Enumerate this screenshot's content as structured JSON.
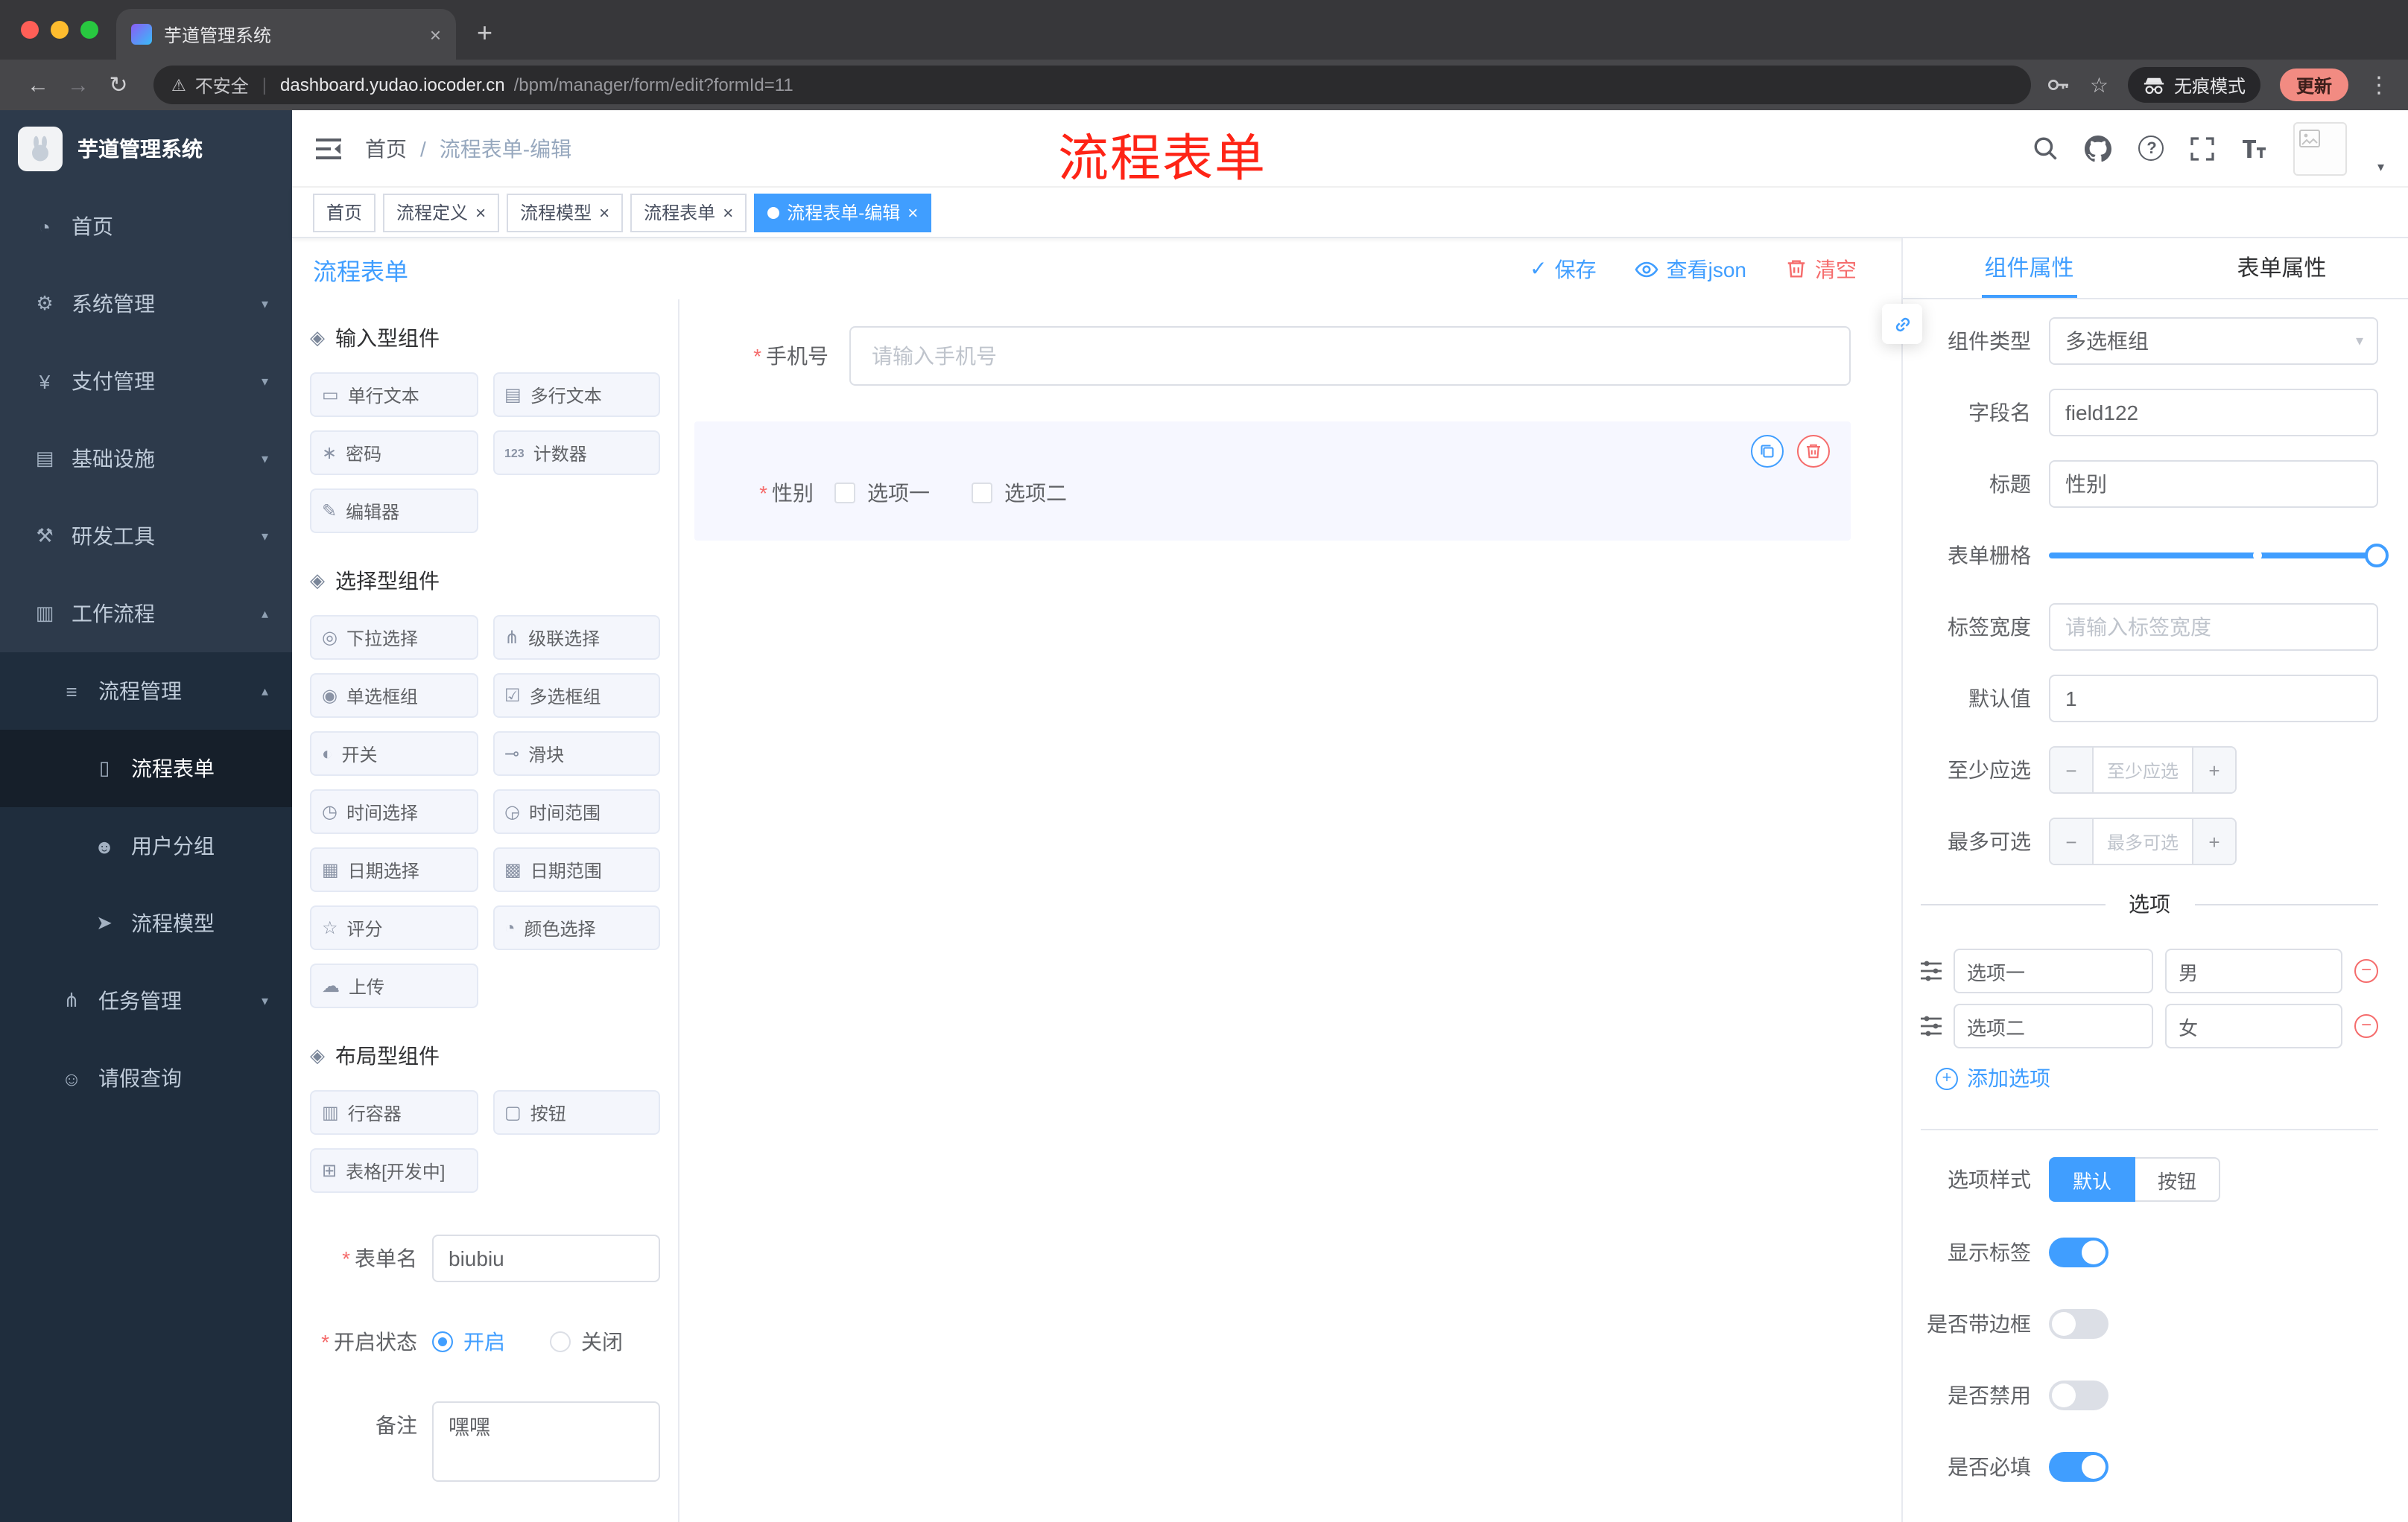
{
  "glyphs": {
    "close": "×",
    "new_tab": "+",
    "back": "←",
    "forward": "→",
    "reload": "↻",
    "warning": "⚠",
    "url_divider": "|",
    "star": "☆",
    "menu_dots": "⋮",
    "required": "*",
    "check": "✓",
    "caret_down": "▾",
    "caret_up": "▴",
    "question": "?",
    "plus": "+",
    "minus": "−",
    "avatar_caret": "▾"
  },
  "browser": {
    "tab_title": "芋道管理系统",
    "secure_label": "不安全",
    "url_domain": "dashboard.yudao.iocoder.cn",
    "url_path": "/bpm/manager/form/edit?formId=11",
    "incognito_label": "无痕模式",
    "update_label": "更新"
  },
  "sidebar": {
    "app_title": "芋道管理系统",
    "items": [
      {
        "label": "首页",
        "glyph": "◔",
        "active": false
      },
      {
        "label": "系统管理",
        "glyph": "⚙",
        "active": false
      },
      {
        "label": "支付管理",
        "glyph": "¥",
        "active": false
      },
      {
        "label": "基础设施",
        "glyph": "▤",
        "active": false
      },
      {
        "label": "研发工具",
        "glyph": "⚒",
        "active": false
      },
      {
        "label": "工作流程",
        "glyph": "▥",
        "active": false
      },
      {
        "label": "流程管理",
        "glyph": "≡",
        "active": false
      },
      {
        "label": "流程表单",
        "glyph": "▯",
        "active": true
      },
      {
        "label": "用户分组",
        "glyph": "☻",
        "active": false
      },
      {
        "label": "流程模型",
        "glyph": "➤",
        "active": false
      },
      {
        "label": "任务管理",
        "glyph": "⋔",
        "active": false
      },
      {
        "label": "请假查询",
        "glyph": "☺",
        "active": false
      }
    ]
  },
  "header": {
    "breadcrumb_home": "首页",
    "breadcrumb_sep": "/",
    "breadcrumb_current": "流程表单-编辑",
    "annotation": "流程表单"
  },
  "tags": {
    "items": [
      {
        "label": "首页",
        "active": false
      },
      {
        "label": "流程定义",
        "active": false
      },
      {
        "label": "流程模型",
        "active": false
      },
      {
        "label": "流程表单",
        "active": false
      },
      {
        "label": "流程表单-编辑",
        "active": true
      }
    ]
  },
  "designer": {
    "title": "流程表单",
    "save_label": "保存",
    "view_json_label": "查看json",
    "clear_label": "清空"
  },
  "palette": {
    "groups": [
      {
        "title": "输入型组件",
        "items": [
          {
            "label": "单行文本",
            "glyph": "▭"
          },
          {
            "label": "多行文本",
            "glyph": "▤"
          },
          {
            "label": "密码",
            "glyph": "∗"
          },
          {
            "label": "计数器",
            "glyph": "123"
          },
          {
            "label": "编辑器",
            "glyph": "✎"
          }
        ]
      },
      {
        "title": "选择型组件",
        "items": [
          {
            "label": "下拉选择",
            "glyph": "◎"
          },
          {
            "label": "级联选择",
            "glyph": "⋔"
          },
          {
            "label": "单选框组",
            "glyph": "◉"
          },
          {
            "label": "多选框组",
            "glyph": "☑"
          },
          {
            "label": "开关",
            "glyph": "◐"
          },
          {
            "label": "滑块",
            "glyph": "⊸"
          },
          {
            "label": "时间选择",
            "glyph": "◷"
          },
          {
            "label": "时间范围",
            "glyph": "◶"
          },
          {
            "label": "日期选择",
            "glyph": "▦"
          },
          {
            "label": "日期范围",
            "glyph": "▩"
          },
          {
            "label": "评分",
            "glyph": "☆"
          },
          {
            "label": "颜色选择",
            "glyph": "◔"
          },
          {
            "label": "上传",
            "glyph": "☁"
          }
        ]
      },
      {
        "title": "布局型组件",
        "items": [
          {
            "label": "行容器",
            "glyph": "▥"
          },
          {
            "label": "按钮",
            "glyph": "▢"
          },
          {
            "label": "表格[开发中]",
            "glyph": "⊞"
          }
        ]
      }
    ],
    "form": {
      "name_label": "表单名",
      "name_value": "biubiu",
      "status_label": "开启状态",
      "status_on": "开启",
      "status_on_selected": true,
      "status_off": "关闭",
      "remark_label": "备注",
      "remark_value": "嘿嘿"
    }
  },
  "canvas": {
    "phone_label": "手机号",
    "phone_placeholder": "请输入手机号",
    "gender_label": "性别",
    "gender_option1": "选项一",
    "gender_option2": "选项二"
  },
  "props": {
    "tabs": [
      {
        "label": "组件属性",
        "active": true
      },
      {
        "label": "表单属性",
        "active": false
      }
    ],
    "component_type_label": "组件类型",
    "component_type_value": "多选框组",
    "field_name_label": "字段名",
    "field_name_value": "field122",
    "title_label": "标题",
    "title_value": "性别",
    "grid_label": "表单栅格",
    "label_width_label": "标签宽度",
    "label_width_placeholder": "请输入标签宽度",
    "default_label": "默认值",
    "default_value": "1",
    "min_label": "至少应选",
    "min_placeholder": "至少应选",
    "max_label": "最多可选",
    "max_placeholder": "最多可选",
    "options_divider": "选项",
    "options": [
      {
        "label": "选项一",
        "value": "男"
      },
      {
        "label": "选项二",
        "value": "女"
      }
    ],
    "add_option": "添加选项",
    "style_label": "选项样式",
    "style_options": [
      {
        "label": "默认",
        "active": true
      },
      {
        "label": "按钮",
        "active": false
      }
    ],
    "toggles": [
      {
        "label": "显示标签",
        "on": true
      },
      {
        "label": "是否带边框",
        "on": false
      },
      {
        "label": "是否禁用",
        "on": false
      },
      {
        "label": "是否必填",
        "on": true
      }
    ],
    "accent_color": "#409eff",
    "danger_color": "#f56c6c"
  }
}
